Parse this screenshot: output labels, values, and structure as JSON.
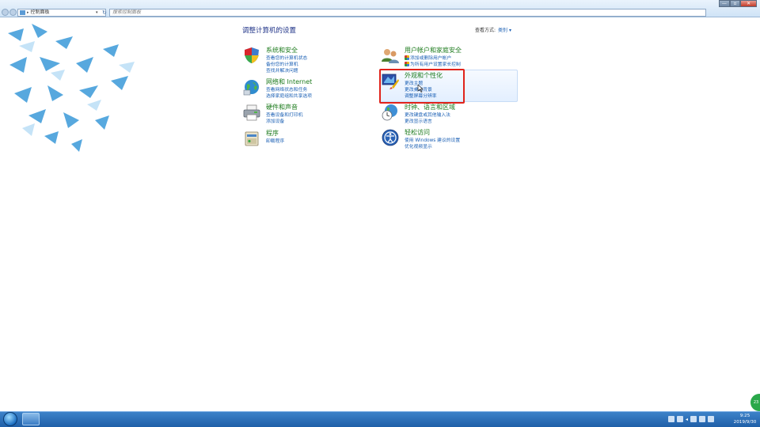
{
  "window": {
    "address_text": "控制面板",
    "search_placeholder": "搜索控制面板",
    "controls": [
      "—",
      "▫",
      "✕"
    ]
  },
  "main": {
    "heading": "调整计算机的设置",
    "view_by_label": "查看方式:",
    "view_by_value": "类别 ▾"
  },
  "categories": [
    {
      "title": "系统和安全",
      "links": [
        "查看您的计算机状态",
        "备份您的计算机",
        "查找并解决问题"
      ]
    },
    {
      "title": "网络和 Internet",
      "links": [
        "查看网络状态和任务",
        "选择家庭组和共享选项"
      ]
    },
    {
      "title": "硬件和声音",
      "links": [
        "查看设备和打印机",
        "添加设备"
      ]
    },
    {
      "title": "程序",
      "links": [
        "卸载程序"
      ]
    },
    {
      "title": "用户帐户和家庭安全",
      "links": [
        "添加或删除用户帐户",
        "为所有用户设置家长控制"
      ]
    },
    {
      "title": "外观和个性化",
      "links": [
        "更改主题",
        "更改桌面背景",
        "调整屏幕分辨率"
      ]
    },
    {
      "title": "时钟、语言和区域",
      "links": [
        "更改键盘或其他输入法",
        "更改显示语言"
      ]
    },
    {
      "title": "轻松访问",
      "links": [
        "使用 Windows 建议的设置",
        "优化视频显示"
      ]
    }
  ],
  "taskbar": {
    "time": "9:25",
    "date": "2019/9/30",
    "badge": "23"
  },
  "colors": {
    "category_title": "#1d7b1d",
    "link": "#1a5fb4",
    "heading": "#1e3287",
    "highlight": "#e0231b"
  }
}
